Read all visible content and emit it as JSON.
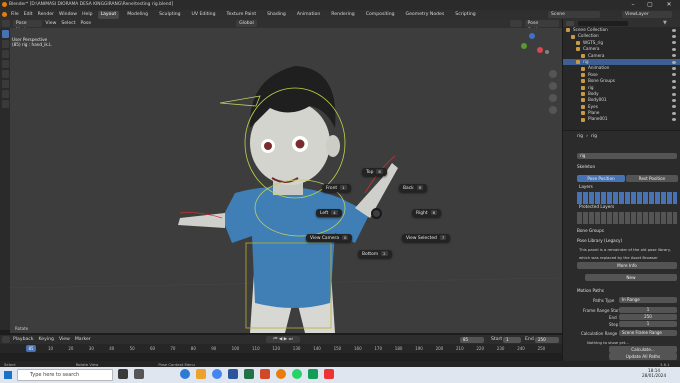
{
  "window": {
    "title": "Blender* [D:\\ANIMASI DIORAMA DESA KINGGIRANG\\Rene\\testing rig.blend]"
  },
  "menu": [
    "File",
    "Edit",
    "Render",
    "Window",
    "Help"
  ],
  "workspaces": [
    "Layout",
    "Modeling",
    "Sculpting",
    "UV Editing",
    "Texture Paint",
    "Shading",
    "Animation",
    "Rendering",
    "Compositing",
    "Geometry Nodes",
    "Scripting"
  ],
  "scene": {
    "label": "Scene",
    "view_layer": "ViewLayer"
  },
  "viewport_header": {
    "mode": "Pose Mode",
    "menus": [
      "View",
      "Select",
      "Pose"
    ],
    "orientation": "Global",
    "pose_options": "Pose Options"
  },
  "overlay": {
    "line1": "User Perspective",
    "line2": "(85) rig : hand_ik.L"
  },
  "pie": {
    "top": "Top",
    "top_key": "8",
    "front": "Front",
    "front_key": "1",
    "back": "Back",
    "back_key": "9",
    "left": "Left",
    "left_key": "4",
    "right": "Right",
    "right_key": "6",
    "camera": "View Camera",
    "camera_key": "0",
    "selected": "View Selected",
    "selected_key": "7",
    "bottom": "Bottom",
    "bottom_key": "2"
  },
  "viewport_footer": "Rotate",
  "timeline": {
    "menus": [
      "Playback",
      "Keying",
      "View",
      "Marker"
    ],
    "current_frame": "85",
    "start_label": "Start",
    "start": "1",
    "end_label": "End",
    "end": "250",
    "ticks": [
      "10",
      "20",
      "30",
      "40",
      "50",
      "60",
      "70",
      "80",
      "90",
      "100",
      "110",
      "120",
      "130",
      "140",
      "150",
      "160",
      "170",
      "180",
      "190",
      "200",
      "210",
      "220",
      "230",
      "240",
      "250"
    ]
  },
  "status": {
    "left": "Select",
    "mid1": "Rotate View",
    "mid2": "Pose Context Menu",
    "right": "3.6.1"
  },
  "outliner": {
    "rows": [
      {
        "label": "Scene Collection",
        "indent": 0
      },
      {
        "label": "Collection",
        "indent": 1
      },
      {
        "label": "WGTS_rig",
        "indent": 2
      },
      {
        "label": "Camera",
        "indent": 2
      },
      {
        "label": "Camera",
        "indent": 3
      },
      {
        "label": "rig",
        "indent": 2,
        "selected": true
      },
      {
        "label": "Animation",
        "indent": 3
      },
      {
        "label": "Pose",
        "indent": 3
      },
      {
        "label": "Bone Groups",
        "indent": 3
      },
      {
        "label": "rig",
        "indent": 3
      },
      {
        "label": "Body",
        "indent": 3
      },
      {
        "label": "Body001",
        "indent": 3
      },
      {
        "label": "Eyes",
        "indent": 3
      },
      {
        "label": "Plane",
        "indent": 3
      },
      {
        "label": "Plane001",
        "indent": 3
      }
    ]
  },
  "props": {
    "object": "rig",
    "data": "rig",
    "skeleton": "Skeleton",
    "pose_position": "Pose Position",
    "rest_position": "Rest Position",
    "layers": "Layers",
    "protected_layers": "Protected Layers",
    "bone_groups": "Bone Groups",
    "pose_library": "Pose Library (Legacy)",
    "pose_lib_text1": "This panel is a remainder of the old pose library,",
    "pose_lib_text2": "which was replaced by the Asset Browser",
    "more_info": "More Info",
    "new": "New",
    "motion_paths": "Motion Paths",
    "paths_type_label": "Paths Type",
    "paths_type": "In Range",
    "frame_range_start_label": "Frame Range Start",
    "frame_range_start": "1",
    "end_label": "End",
    "end": "250",
    "step_label": "Step",
    "step": "1",
    "calc_range_label": "Calculation Range",
    "calc_range": "Scene Frame Range",
    "nothing_to_show": "Nothing to show yet...",
    "calculate": "Calculate...",
    "update_all": "Update All Paths"
  },
  "taskbar": {
    "search": "Type here to search",
    "time": "18:14",
    "date": "28/01/2024"
  }
}
